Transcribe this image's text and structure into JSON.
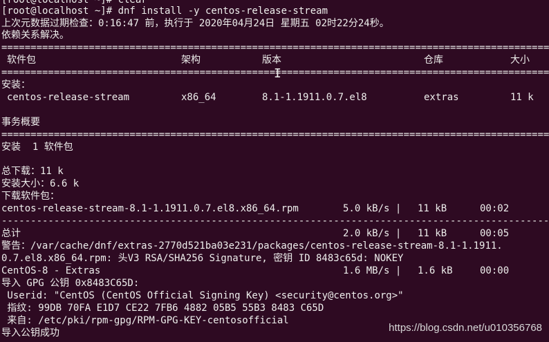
{
  "terminal": {
    "top_line": "[root@localhost ~]# clear",
    "prompt": "[root@localhost ~]# dnf install -y centos-release-stream",
    "metadata_check": "上次元数据过期检查：0:16:47 前，执行于 2020年04月24日 星期五 02时22分24秒。",
    "resolving": "依赖关系解决。",
    "separator_eq": "===============================================================================================",
    "separator_dash": "-----------------------------------------------------------------------------------------------",
    "table_headers": {
      "package": "软件包",
      "arch": "架构",
      "version": "版本",
      "repo": "仓库",
      "size": "大小"
    },
    "installing_label": "安装：",
    "package_row": {
      "package": "centos-release-stream",
      "arch": "x86_64",
      "version": "8.1-1.1911.0.7.el8",
      "repo": "extras",
      "size": "11 k"
    },
    "transaction_summary": "事务概要",
    "install_count": "安装  1 软件包",
    "total_download": "总下载：11 k",
    "installed_size": "安装大小：6.6 k",
    "downloading_packages": "下载软件包：",
    "download_row": {
      "file": "centos-release-stream-8.1-1.1911.0.7.el8.x86_64.rpm",
      "speed": "5.0 kB/s |",
      "size": "11 kB",
      "time": "00:02"
    },
    "total_row": {
      "label": "总计",
      "speed": "2.0 kB/s |",
      "size": "11 kB",
      "time": "00:05"
    },
    "warning_line1": "警告：/var/cache/dnf/extras-2770d521ba03e231/packages/centos-release-stream-8.1-1.1911.",
    "warning_line2": "0.7.el8.x86_64.rpm: 头V3 RSA/SHA256 Signature, 密钥 ID 8483c65d: NOKEY",
    "repo_row": {
      "label": "CentOS-8 - Extras",
      "speed": "1.6 MB/s |",
      "size": "1.6 kB",
      "time": "00:00"
    },
    "import_key": "导入 GPG 公钥 0x8483C65D:",
    "userid": " Userid: \"CentOS (CentOS Official Signing Key) <security@centos.org>\"",
    "fingerprint": " 指纹: 99DB 70FA E1D7 CE22 7FB6 4882 05B5 55B3 8483 C65D",
    "from": " 来自: /etc/pki/rpm-gpg/RPM-GPG-KEY-centosofficial",
    "import_success": "导入公钥成功",
    "cursor_glyph": "I"
  },
  "watermark": "https://blog.csdn.net/u010356768"
}
